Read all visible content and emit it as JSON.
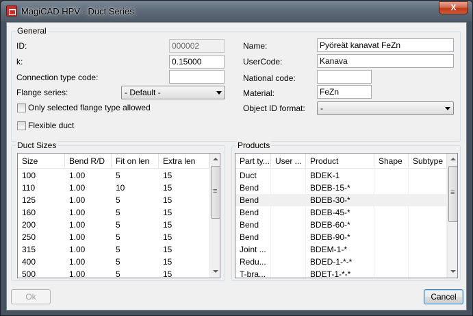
{
  "window": {
    "title": "MagiCAD HPV - Duct Series",
    "close_glyph": "X"
  },
  "general": {
    "legend": "General",
    "id_label": "ID:",
    "id_value": "000002",
    "k_label": "k:",
    "k_value": "0.15000",
    "connection_label": "Connection type code:",
    "connection_value": "",
    "flange_label": "Flange series:",
    "flange_value": "- Default -",
    "only_selected_label": "Only selected flange type allowed",
    "flexible_label": "Flexible duct",
    "name_label": "Name:",
    "name_value": "Pyöreät kanavat FeZn",
    "usercode_label": "UserCode:",
    "usercode_value": "Kanava",
    "national_label": "National code:",
    "national_value": "",
    "material_label": "Material:",
    "material_value": "FeZn",
    "objectid_label": "Object ID format:",
    "objectid_value": "-"
  },
  "duct_sizes": {
    "legend": "Duct Sizes",
    "columns": [
      "Size",
      "Bend R/D",
      "Fit on len",
      "Extra len"
    ],
    "rows": [
      [
        "100",
        "1.00",
        "5",
        "15"
      ],
      [
        "110",
        "1.00",
        "10",
        "15"
      ],
      [
        "125",
        "1.00",
        "5",
        "15"
      ],
      [
        "160",
        "1.00",
        "5",
        "15"
      ],
      [
        "200",
        "1.00",
        "5",
        "15"
      ],
      [
        "250",
        "1.00",
        "5",
        "15"
      ],
      [
        "315",
        "1.00",
        "5",
        "15"
      ],
      [
        "400",
        "1.00",
        "5",
        "15"
      ],
      [
        "500",
        "1.00",
        "5",
        "15"
      ]
    ]
  },
  "products": {
    "legend": "Products",
    "columns": [
      "Part ty...",
      "User ...",
      "Product",
      "Shape",
      "Subtype"
    ],
    "rows": [
      [
        "Duct",
        "",
        "BDEK-1",
        "",
        ""
      ],
      [
        "Bend",
        "",
        "BDEB-15-*",
        "",
        ""
      ],
      [
        "Bend",
        "",
        "BDEB-30-*",
        "",
        ""
      ],
      [
        "Bend",
        "",
        "BDEB-45-*",
        "",
        ""
      ],
      [
        "Bend",
        "",
        "BDEB-60-*",
        "",
        ""
      ],
      [
        "Bend",
        "",
        "BDEB-90-*",
        "",
        ""
      ],
      [
        "Joint ...",
        "",
        "BDEM-1-*",
        "",
        ""
      ],
      [
        "Redu...",
        "",
        "BDED-1-*-*",
        "",
        ""
      ],
      [
        "T-bra...",
        "",
        "BDET-1-*-*",
        "",
        ""
      ]
    ]
  },
  "buttons": {
    "ok": "Ok",
    "cancel": "Cancel"
  }
}
